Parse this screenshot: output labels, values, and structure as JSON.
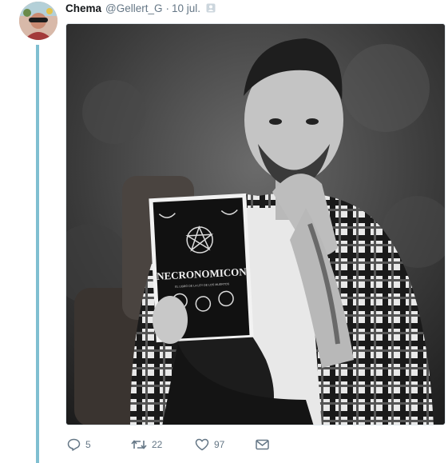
{
  "tweet": {
    "author_name": "Chema",
    "author_handle": "@Gellert_G",
    "separator": "·",
    "date": "10 jul.",
    "media": {
      "book_title": "NECRONOMICON",
      "book_subtitle": "EL LIBRO DE LA LEY DE LOS MUERTOS"
    },
    "actions": {
      "replies": "5",
      "retweets": "22",
      "likes": "97"
    }
  },
  "icons": {
    "reply": "reply-icon",
    "retweet": "retweet-icon",
    "like": "heart-icon",
    "dm": "envelope-icon",
    "badge": "follow-badge-icon"
  },
  "colors": {
    "thread_line": "#80bfd1",
    "muted": "#657786",
    "text": "#14171a"
  }
}
